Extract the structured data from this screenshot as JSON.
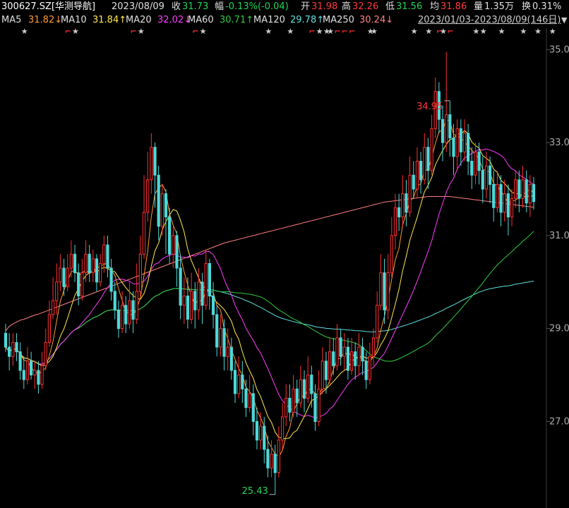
{
  "header": {
    "code": "300627.SZ[华测导航]",
    "date": "2023/08/09",
    "close_label": "收",
    "close": "31.73",
    "change_label": "幅",
    "change": "-0.13%(-0.04)",
    "open_label": "开",
    "open": "31.98",
    "high_label": "高",
    "high": "32.26",
    "low_label": "低",
    "low": "31.56",
    "avg_label": "均",
    "avg": "31.86",
    "vol_label": "量",
    "vol": "1.35万",
    "turnover_label": "换",
    "turnover": "0.31%"
  },
  "ma_legend": [
    {
      "name": "MA5",
      "value": "31.82↓",
      "color": "#ff9a2e"
    },
    {
      "name": "MA10",
      "value": "31.84↑",
      "color": "#ffe94a"
    },
    {
      "name": "MA20",
      "value": "32.02↓",
      "color": "#ff3cff"
    },
    {
      "name": "MA60",
      "value": "30.71↑",
      "color": "#2ecc40"
    },
    {
      "name": "MA120",
      "value": "29.78↑",
      "color": "#5fe0e0"
    },
    {
      "name": "MA250",
      "value": "30.24↓",
      "color": "#ff8080"
    }
  ],
  "range_label": "2023/01/03-2023/08/09(146日)",
  "marker_glyphs": {
    "star": "★",
    "flag": "⌐"
  },
  "colors": {
    "up": "#ff3030",
    "down": "#4fd8d8",
    "bg": "#000000"
  },
  "chart_data": {
    "type": "candlestick",
    "y_ticks": [
      "35.0",
      "33.0",
      "31.0",
      "29.0",
      "27.0"
    ],
    "ylim": [
      25.2,
      35.4
    ],
    "max_label": "34.95",
    "min_label": "25.43",
    "max_index": 122,
    "min_index": 74,
    "events": [
      {
        "i": 5,
        "type": "star"
      },
      {
        "i": 17,
        "type": "flag"
      },
      {
        "i": 19,
        "type": "star"
      },
      {
        "i": 35,
        "type": "flag"
      },
      {
        "i": 37,
        "type": "star"
      },
      {
        "i": 52,
        "type": "flag"
      },
      {
        "i": 54,
        "type": "star"
      },
      {
        "i": 72,
        "type": "star"
      },
      {
        "i": 78,
        "type": "star"
      },
      {
        "i": 84,
        "type": "flag"
      },
      {
        "i": 86,
        "type": "star"
      },
      {
        "i": 88,
        "type": "star"
      },
      {
        "i": 89,
        "type": "star"
      },
      {
        "i": 91,
        "type": "flag"
      },
      {
        "i": 93,
        "type": "flag"
      },
      {
        "i": 95,
        "type": "flag"
      },
      {
        "i": 100,
        "type": "star"
      },
      {
        "i": 101,
        "type": "star"
      },
      {
        "i": 112,
        "type": "star"
      },
      {
        "i": 116,
        "type": "star"
      },
      {
        "i": 119,
        "type": "flag"
      },
      {
        "i": 120,
        "type": "star"
      },
      {
        "i": 122,
        "type": "flag"
      },
      {
        "i": 129,
        "type": "star"
      },
      {
        "i": 131,
        "type": "star"
      },
      {
        "i": 136,
        "type": "star"
      },
      {
        "i": 142,
        "type": "star"
      },
      {
        "i": 146,
        "type": "star"
      },
      {
        "i": 150,
        "type": "star"
      }
    ],
    "candles": [
      [
        28.9,
        28.6,
        29.1,
        28.5
      ],
      [
        28.6,
        28.4,
        28.9,
        28.1
      ],
      [
        28.4,
        28.7,
        28.9,
        28.2
      ],
      [
        28.7,
        28.5,
        28.9,
        28.3
      ],
      [
        28.5,
        28.1,
        28.7,
        27.9
      ],
      [
        28.1,
        27.9,
        28.4,
        27.7
      ],
      [
        27.9,
        28.3,
        28.6,
        27.8
      ],
      [
        28.3,
        28.0,
        28.5,
        27.9
      ],
      [
        28.0,
        28.1,
        28.3,
        27.7
      ],
      [
        28.1,
        27.8,
        28.3,
        27.6
      ],
      [
        27.8,
        28.2,
        28.5,
        27.7
      ],
      [
        28.2,
        28.7,
        29.0,
        28.1
      ],
      [
        28.7,
        29.3,
        29.6,
        28.6
      ],
      [
        29.3,
        29.6,
        30.1,
        29.2
      ],
      [
        29.6,
        30.0,
        30.4,
        29.3
      ],
      [
        30.0,
        30.3,
        30.6,
        29.8
      ],
      [
        30.3,
        29.9,
        30.5,
        29.7
      ],
      [
        29.9,
        30.3,
        30.6,
        29.8
      ],
      [
        30.3,
        30.6,
        30.9,
        30.1
      ],
      [
        30.6,
        30.2,
        30.8,
        30.0
      ],
      [
        30.2,
        29.7,
        30.4,
        29.5
      ],
      [
        29.7,
        30.2,
        30.5,
        29.6
      ],
      [
        30.2,
        30.6,
        30.9,
        30.0
      ],
      [
        30.6,
        30.2,
        30.8,
        30.0
      ],
      [
        30.2,
        30.5,
        30.7,
        30.0
      ],
      [
        30.5,
        30.0,
        30.6,
        29.8
      ],
      [
        30.0,
        30.4,
        30.6,
        29.9
      ],
      [
        30.4,
        30.8,
        31.0,
        30.2
      ],
      [
        30.8,
        30.3,
        31.0,
        30.1
      ],
      [
        30.3,
        29.8,
        30.5,
        29.6
      ],
      [
        29.8,
        29.4,
        30.0,
        29.2
      ],
      [
        29.4,
        29.0,
        29.6,
        28.8
      ],
      [
        29.0,
        29.5,
        29.8,
        28.9
      ],
      [
        29.5,
        29.1,
        29.7,
        28.9
      ],
      [
        29.1,
        29.6,
        30.0,
        29.0
      ],
      [
        29.6,
        29.2,
        29.8,
        28.9
      ],
      [
        29.2,
        29.8,
        30.4,
        29.1
      ],
      [
        29.8,
        30.6,
        31.0,
        29.7
      ],
      [
        30.6,
        31.5,
        32.3,
        30.5
      ],
      [
        31.5,
        32.2,
        32.8,
        31.3
      ],
      [
        32.2,
        32.9,
        33.2,
        31.9
      ],
      [
        32.9,
        32.3,
        33.0,
        31.6
      ],
      [
        32.3,
        31.2,
        32.5,
        30.9
      ],
      [
        31.2,
        31.9,
        32.1,
        31.0
      ],
      [
        31.9,
        31.4,
        32.0,
        30.6
      ],
      [
        31.4,
        30.6,
        31.6,
        30.4
      ],
      [
        30.6,
        31.0,
        31.2,
        30.3
      ],
      [
        31.0,
        30.3,
        31.1,
        29.9
      ],
      [
        30.3,
        29.5,
        30.6,
        29.2
      ],
      [
        29.5,
        29.7,
        30.1,
        29.1
      ],
      [
        29.7,
        29.2,
        30.1,
        29.0
      ],
      [
        29.2,
        29.8,
        30.2,
        29.1
      ],
      [
        29.8,
        29.4,
        30.0,
        29.0
      ],
      [
        29.4,
        30.0,
        30.3,
        29.2
      ],
      [
        30.0,
        29.5,
        30.2,
        29.1
      ],
      [
        29.5,
        30.4,
        30.7,
        29.4
      ],
      [
        30.4,
        29.7,
        30.5,
        29.4
      ],
      [
        29.7,
        29.3,
        30.0,
        29.0
      ],
      [
        29.3,
        28.6,
        29.5,
        28.4
      ],
      [
        28.6,
        29.0,
        29.3,
        28.4
      ],
      [
        29.0,
        28.4,
        29.2,
        28.1
      ],
      [
        28.4,
        28.6,
        29.0,
        28.1
      ],
      [
        28.6,
        28.1,
        28.8,
        27.9
      ],
      [
        28.1,
        27.6,
        28.3,
        27.4
      ],
      [
        27.6,
        28.0,
        28.4,
        27.5
      ],
      [
        28.0,
        27.7,
        28.3,
        27.4
      ],
      [
        27.7,
        27.3,
        27.9,
        27.1
      ],
      [
        27.3,
        27.6,
        28.0,
        27.2
      ],
      [
        27.6,
        27.0,
        27.8,
        26.7
      ],
      [
        27.0,
        26.6,
        27.3,
        26.4
      ],
      [
        26.6,
        26.9,
        27.2,
        26.4
      ],
      [
        26.9,
        26.4,
        27.1,
        26.1
      ],
      [
        26.4,
        26.0,
        26.7,
        25.8
      ],
      [
        26.0,
        26.3,
        26.6,
        25.8
      ],
      [
        26.3,
        25.9,
        26.5,
        25.43
      ],
      [
        25.9,
        26.6,
        26.9,
        25.8
      ],
      [
        26.6,
        27.1,
        27.4,
        26.4
      ],
      [
        27.1,
        27.5,
        27.8,
        26.9
      ],
      [
        27.5,
        27.2,
        27.8,
        27.0
      ],
      [
        27.2,
        27.7,
        28.0,
        27.1
      ],
      [
        27.7,
        27.4,
        27.9,
        27.1
      ],
      [
        27.4,
        27.9,
        28.2,
        27.3
      ],
      [
        27.9,
        27.5,
        28.1,
        27.2
      ],
      [
        27.5,
        28.0,
        28.4,
        27.4
      ],
      [
        28.0,
        27.6,
        28.2,
        27.3
      ],
      [
        27.6,
        27.0,
        27.8,
        26.8
      ],
      [
        27.0,
        27.7,
        28.1,
        26.9
      ],
      [
        27.7,
        28.3,
        28.6,
        27.6
      ],
      [
        28.3,
        27.9,
        28.5,
        27.6
      ],
      [
        27.9,
        28.5,
        28.8,
        27.8
      ],
      [
        28.5,
        28.2,
        28.8,
        28.0
      ],
      [
        28.2,
        28.8,
        29.1,
        28.1
      ],
      [
        28.8,
        28.4,
        29.0,
        28.2
      ],
      [
        28.4,
        28.6,
        28.9,
        28.1
      ],
      [
        28.6,
        28.1,
        28.8,
        27.9
      ],
      [
        28.1,
        28.5,
        28.8,
        28.0
      ],
      [
        28.5,
        28.2,
        28.7,
        27.9
      ],
      [
        28.2,
        28.6,
        28.9,
        28.0
      ],
      [
        28.6,
        28.3,
        28.8,
        28.0
      ],
      [
        28.3,
        27.9,
        28.5,
        27.7
      ],
      [
        27.9,
        28.4,
        28.7,
        27.8
      ],
      [
        28.4,
        28.8,
        29.0,
        28.2
      ],
      [
        28.8,
        29.5,
        29.8,
        28.7
      ],
      [
        29.5,
        30.2,
        30.6,
        29.4
      ],
      [
        30.2,
        29.4,
        30.5,
        29.1
      ],
      [
        29.4,
        30.2,
        30.6,
        29.2
      ],
      [
        30.2,
        31.0,
        31.4,
        30.1
      ],
      [
        31.0,
        31.6,
        31.9,
        30.7
      ],
      [
        31.6,
        31.4,
        31.9,
        31.1
      ],
      [
        31.4,
        31.9,
        32.3,
        31.2
      ],
      [
        31.9,
        31.5,
        32.2,
        31.2
      ],
      [
        31.5,
        32.3,
        32.7,
        31.4
      ],
      [
        32.3,
        32.0,
        32.6,
        31.8
      ],
      [
        32.0,
        32.6,
        32.9,
        31.8
      ],
      [
        32.6,
        32.2,
        32.8,
        31.9
      ],
      [
        32.2,
        32.9,
        33.2,
        32.1
      ],
      [
        32.9,
        32.4,
        33.1,
        32.0
      ],
      [
        32.4,
        33.3,
        33.6,
        32.3
      ],
      [
        33.3,
        34.1,
        34.4,
        33.1
      ],
      [
        34.1,
        33.5,
        34.3,
        33.2
      ],
      [
        33.5,
        33.0,
        33.8,
        32.6
      ],
      [
        33.0,
        33.6,
        34.95,
        32.8
      ],
      [
        33.6,
        33.1,
        33.9,
        32.7
      ],
      [
        33.1,
        32.7,
        33.4,
        32.3
      ],
      [
        32.7,
        33.3,
        33.5,
        32.4
      ],
      [
        33.3,
        32.8,
        33.5,
        32.5
      ],
      [
        32.8,
        33.2,
        33.5,
        32.6
      ],
      [
        33.2,
        32.6,
        33.4,
        32.3
      ],
      [
        32.6,
        32.3,
        32.9,
        32.0
      ],
      [
        32.3,
        32.8,
        33.0,
        32.1
      ],
      [
        32.8,
        32.4,
        33.0,
        32.1
      ],
      [
        32.4,
        32.0,
        32.7,
        31.7
      ],
      [
        32.0,
        32.5,
        32.8,
        31.8
      ],
      [
        32.5,
        32.1,
        32.7,
        31.7
      ],
      [
        32.1,
        31.6,
        32.4,
        31.3
      ],
      [
        31.6,
        32.1,
        32.4,
        31.5
      ],
      [
        32.1,
        31.5,
        32.3,
        31.2
      ],
      [
        31.5,
        31.9,
        32.2,
        31.3
      ],
      [
        31.9,
        31.4,
        32.1,
        31.0
      ],
      [
        31.4,
        31.8,
        32.0,
        31.2
      ],
      [
        31.8,
        32.2,
        32.4,
        31.6
      ],
      [
        32.2,
        31.8,
        32.4,
        31.5
      ],
      [
        31.8,
        32.2,
        32.5,
        31.6
      ],
      [
        32.2,
        31.7,
        32.4,
        31.5
      ],
      [
        31.7,
        32.1,
        32.3,
        31.4
      ],
      [
        32.1,
        31.73,
        32.26,
        31.56
      ]
    ],
    "ma_series": [
      {
        "name": "MA250",
        "values": [
          28.95,
          29.05,
          29.1,
          29.14,
          29.18,
          29.2,
          29.23,
          29.26,
          29.29,
          29.31,
          29.34,
          29.37,
          29.4,
          29.43,
          29.46,
          29.49,
          29.52,
          29.55,
          29.58,
          29.61,
          29.64,
          29.67,
          29.7,
          29.73,
          29.76,
          29.79,
          29.82,
          29.85,
          29.88,
          29.91,
          29.94,
          29.97,
          30.0,
          30.03,
          30.06,
          30.09,
          30.12,
          30.15,
          30.18,
          30.21,
          30.24,
          30.27,
          30.3,
          30.33,
          30.36,
          30.39,
          30.42,
          30.45,
          30.48,
          30.51,
          30.54,
          30.57,
          30.6,
          30.63,
          30.66,
          30.69,
          30.72,
          30.75,
          30.78,
          30.81,
          30.84,
          30.86,
          30.88,
          30.9,
          30.92,
          30.94,
          30.96,
          30.98,
          31.0,
          31.02,
          31.04,
          31.06,
          31.08,
          31.1,
          31.12,
          31.14,
          31.16,
          31.18,
          31.2,
          31.22,
          31.24,
          31.26,
          31.28,
          31.3,
          31.32,
          31.34,
          31.36,
          31.38,
          31.4,
          31.42,
          31.44,
          31.46,
          31.48,
          31.5,
          31.52,
          31.54,
          31.56,
          31.58,
          31.6,
          31.62,
          31.64,
          31.66,
          31.68,
          31.7,
          31.72,
          31.73,
          31.74,
          31.75,
          31.76,
          31.77,
          31.78,
          31.79,
          31.8,
          31.81,
          31.82,
          31.83,
          31.84,
          31.84,
          31.84,
          31.84,
          31.84,
          31.84,
          31.84,
          31.83,
          31.82,
          31.81,
          31.8,
          31.79,
          31.78,
          31.77,
          31.76,
          31.75,
          31.74,
          31.73,
          31.72,
          31.71,
          31.7,
          31.69,
          31.68,
          31.67,
          31.66,
          31.65,
          31.64,
          31.63,
          31.62,
          31.61,
          31.6,
          31.59,
          31.58,
          31.57,
          31.56,
          31.55,
          31.54
        ]
      }
    ]
  }
}
